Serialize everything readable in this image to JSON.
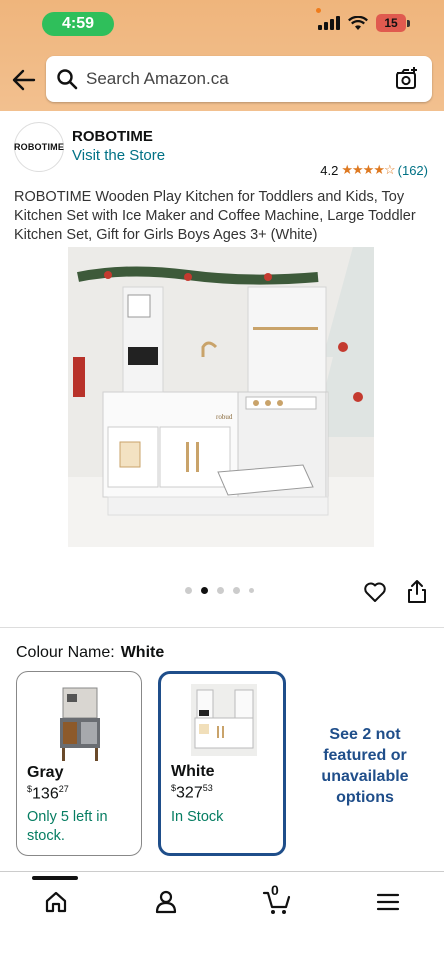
{
  "status_bar": {
    "time": "4:59",
    "battery": "15"
  },
  "search": {
    "placeholder": "Search Amazon.ca"
  },
  "brand": {
    "logo_text": "ROBOTIME",
    "name": "ROBOTIME",
    "store_link": "Visit the Store"
  },
  "rating": {
    "value": "4.2",
    "stars": "★★★★☆",
    "count": "(162)"
  },
  "product": {
    "title": "ROBOTIME Wooden Play Kitchen for Toddlers and Kids, Toy Kitchen Set with Ice Maker and Coffee Machine, Large Toddler Kitchen Set, Gift for Girls Boys Ages 3+ (White)",
    "image_label": "robud",
    "image_count": 5,
    "active_image": 2
  },
  "colour": {
    "label": "Colour Name:",
    "selected": "White"
  },
  "swatches": [
    {
      "name": "Gray",
      "currency": "$",
      "whole": "136",
      "fraction": "27",
      "stock": "Only 5 left in stock."
    },
    {
      "name": "White",
      "currency": "$",
      "whole": "327",
      "fraction": "53",
      "stock": "In Stock"
    }
  ],
  "more_options": "See 2 not featured or unavailable options",
  "nav": {
    "cart_count": "0"
  },
  "colors": {
    "accent_blue": "#1f4e8a",
    "link": "#007185",
    "stock_green": "#067d62",
    "star": "#de7921"
  }
}
